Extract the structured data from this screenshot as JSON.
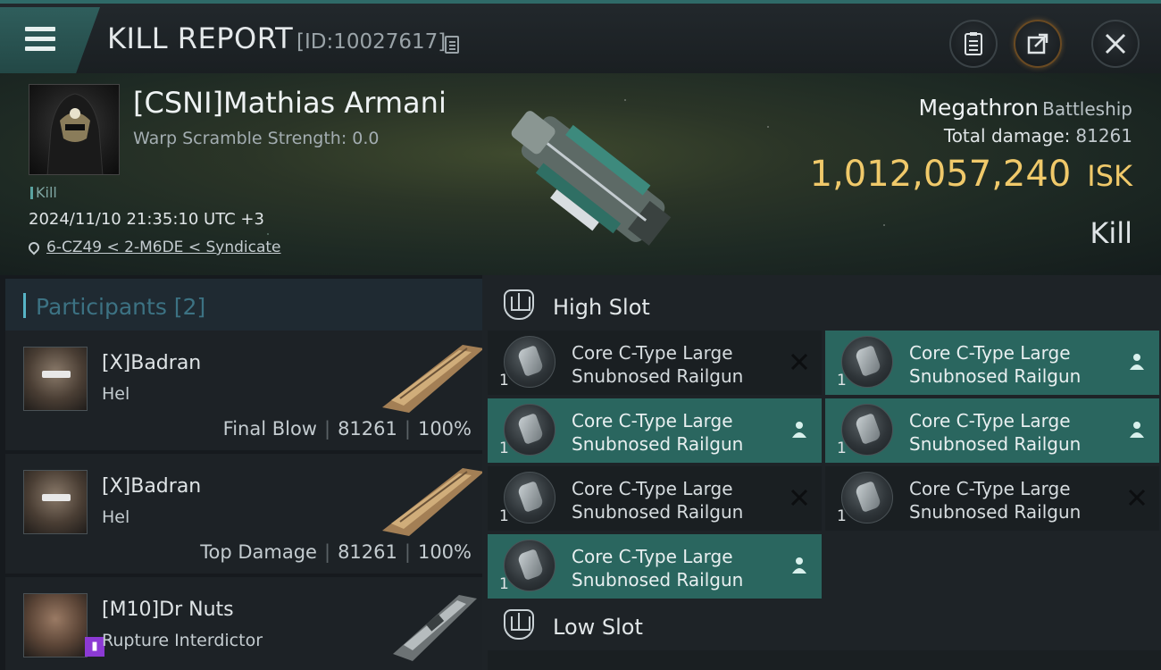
{
  "header": {
    "title": "KILL REPORT",
    "kill_id": "[ID:10027617]"
  },
  "victim": {
    "name": "[CSNI]Mathias Armani",
    "warp_scramble": "Warp Scramble Strength: 0.0",
    "kill_tag": "Kill",
    "datetime": "2024/11/10 21:35:10 UTC +3",
    "location": "6-CZ49 < 2-M6DE < Syndicate",
    "ship_name": "Megathron",
    "ship_class": "Battleship",
    "total_damage_label": "Total damage:",
    "total_damage": "81261",
    "isk_value": "1,012,057,240",
    "isk_unit": "ISK",
    "result": "Kill"
  },
  "participants": {
    "label": "Participants [2]",
    "items": [
      {
        "name": "[X]Badran",
        "ship": "Hel",
        "role": "Final Blow",
        "damage": "81261",
        "percent": "100%"
      },
      {
        "name": "[X]Badran",
        "ship": "Hel",
        "role": "Top Damage",
        "damage": "81261",
        "percent": "100%"
      },
      {
        "name": "[M10]Dr Nuts",
        "ship": "Rupture Interdictor"
      }
    ]
  },
  "fitting": {
    "high_slot_label": "High Slot",
    "low_slot_label": "Low Slot",
    "high_modules": [
      {
        "name": "Core C-Type Large\nSnubnosed Railgun",
        "qty": "1",
        "status": "destroyed",
        "status_icon": "close-x-icon"
      },
      {
        "name": "Core C-Type Large\nSnubnosed Railgun",
        "qty": "1",
        "status": "dropped",
        "status_icon": "person-icon"
      },
      {
        "name": "Core C-Type Large\nSnubnosed Railgun",
        "qty": "1",
        "status": "dropped",
        "status_icon": "person-icon"
      },
      {
        "name": "Core C-Type Large\nSnubnosed Railgun",
        "qty": "1",
        "status": "dropped",
        "status_icon": "person-icon"
      },
      {
        "name": "Core C-Type Large\nSnubnosed Railgun",
        "qty": "1",
        "status": "destroyed",
        "status_icon": "close-x-icon"
      },
      {
        "name": "Core C-Type Large\nSnubnosed Railgun",
        "qty": "1",
        "status": "destroyed",
        "status_icon": "close-x-icon"
      },
      {
        "name": "Core C-Type Large\nSnubnosed Railgun",
        "qty": "1",
        "status": "dropped",
        "status_icon": "person-icon"
      }
    ]
  },
  "colors": {
    "accent_teal": "#2a665f",
    "isk_gold": "#f0c96a",
    "participants_label": "#3c7283",
    "corp_badge": "#8c3ad4"
  }
}
